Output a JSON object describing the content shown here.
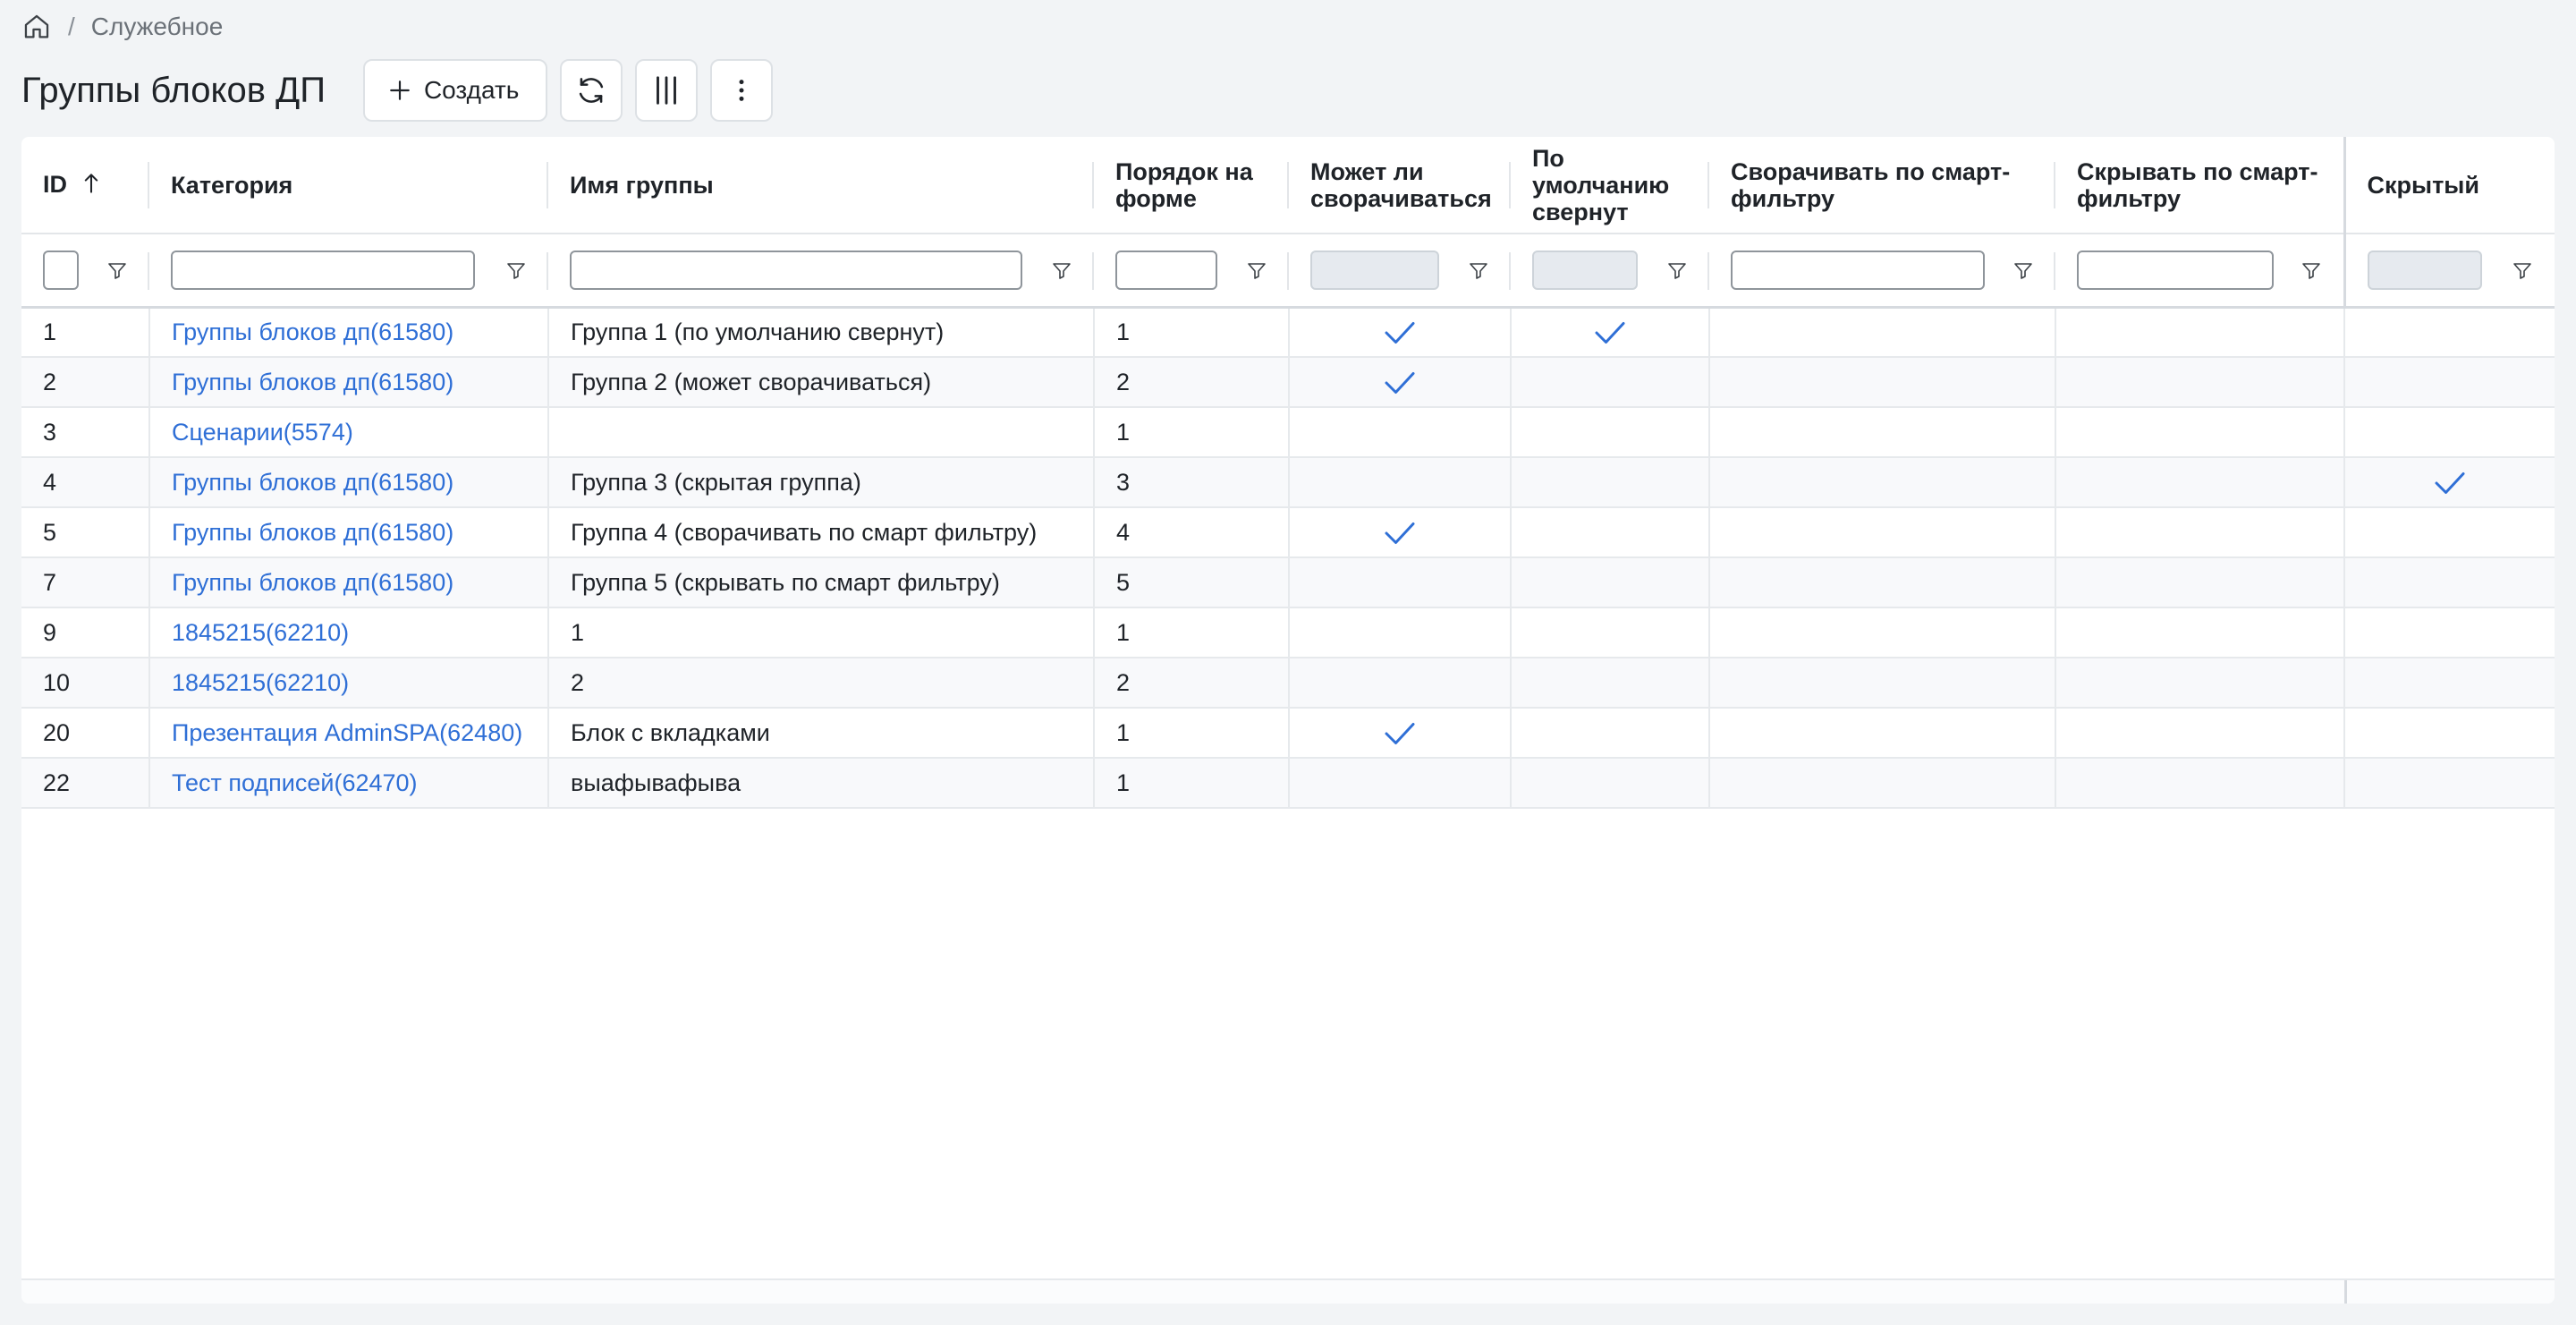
{
  "breadcrumb": {
    "home_icon": "home-icon",
    "separator": "/",
    "current": "Служебное"
  },
  "page": {
    "title": "Группы блоков ДП"
  },
  "toolbar": {
    "create_label": "Создать",
    "refresh_icon": "refresh-icon",
    "columns_icon": "columns-icon",
    "more_icon": "more-vertical-icon"
  },
  "colors": {
    "link": "#2f6fd6",
    "check": "#2f6fd6",
    "background": "#f2f4f6"
  },
  "table": {
    "columns": [
      {
        "key": "id",
        "label": "ID",
        "sort": "asc"
      },
      {
        "key": "category",
        "label": "Категория"
      },
      {
        "key": "name",
        "label": "Имя группы"
      },
      {
        "key": "order",
        "label": "Порядок на форме"
      },
      {
        "key": "collapsible",
        "label": "Может ли сворачиваться"
      },
      {
        "key": "collapsed_default",
        "label": "По умолчанию свернут"
      },
      {
        "key": "collapse_smart",
        "label": "Сворачивать по смарт-фильтру"
      },
      {
        "key": "hide_smart",
        "label": "Скрывать по смарт-фильтру"
      },
      {
        "key": "hidden",
        "label": "Скрытый"
      }
    ],
    "filters": {
      "id": "",
      "category": "",
      "name": "",
      "order": "",
      "collapsible": "",
      "collapsed_default": "",
      "collapse_smart": "",
      "hide_smart": "",
      "hidden": ""
    },
    "rows": [
      {
        "id": "1",
        "category": "Группы блоков дп(61580)",
        "name": "Группа 1 (по умолчанию свернут)",
        "order": "1",
        "collapsible": true,
        "collapsed_default": true,
        "collapse_smart": false,
        "hide_smart": false,
        "hidden": false
      },
      {
        "id": "2",
        "category": "Группы блоков дп(61580)",
        "name": "Группа 2 (может сворачиваться)",
        "order": "2",
        "collapsible": true,
        "collapsed_default": false,
        "collapse_smart": false,
        "hide_smart": false,
        "hidden": false
      },
      {
        "id": "3",
        "category": "Сценарии(5574)",
        "name": "",
        "order": "1",
        "collapsible": false,
        "collapsed_default": false,
        "collapse_smart": false,
        "hide_smart": false,
        "hidden": false
      },
      {
        "id": "4",
        "category": "Группы блоков дп(61580)",
        "name": "Группа 3 (скрытая группа)",
        "order": "3",
        "collapsible": false,
        "collapsed_default": false,
        "collapse_smart": false,
        "hide_smart": false,
        "hidden": true
      },
      {
        "id": "5",
        "category": "Группы блоков дп(61580)",
        "name": "Группа 4 (сворачивать по смарт фильтру)",
        "order": "4",
        "collapsible": true,
        "collapsed_default": false,
        "collapse_smart": false,
        "hide_smart": false,
        "hidden": false
      },
      {
        "id": "7",
        "category": "Группы блоков дп(61580)",
        "name": "Группа 5 (скрывать по смарт фильтру)",
        "order": "5",
        "collapsible": false,
        "collapsed_default": false,
        "collapse_smart": false,
        "hide_smart": false,
        "hidden": false
      },
      {
        "id": "9",
        "category": "1845215(62210)",
        "name": "1",
        "order": "1",
        "collapsible": false,
        "collapsed_default": false,
        "collapse_smart": false,
        "hide_smart": false,
        "hidden": false
      },
      {
        "id": "10",
        "category": "1845215(62210)",
        "name": "2",
        "order": "2",
        "collapsible": false,
        "collapsed_default": false,
        "collapse_smart": false,
        "hide_smart": false,
        "hidden": false
      },
      {
        "id": "20",
        "category": "Презентация AdminSPA(62480)",
        "name": "Блок с вкладками",
        "order": "1",
        "collapsible": true,
        "collapsed_default": false,
        "collapse_smart": false,
        "hide_smart": false,
        "hidden": false
      },
      {
        "id": "22",
        "category": "Тест подписей(62470)",
        "name": "выафывафыва",
        "order": "1",
        "collapsible": false,
        "collapsed_default": false,
        "collapse_smart": false,
        "hide_smart": false,
        "hidden": false
      }
    ]
  }
}
